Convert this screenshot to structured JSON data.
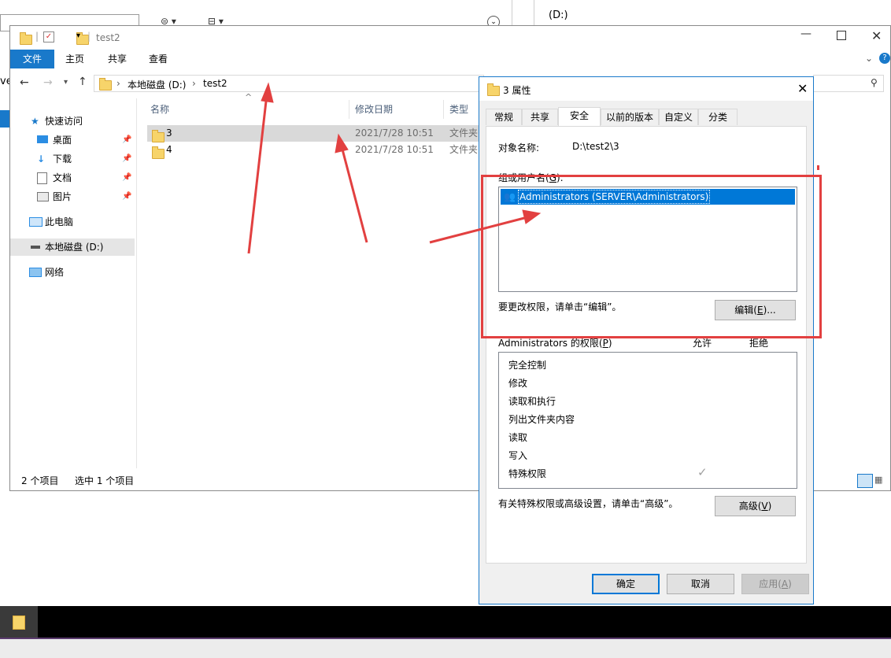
{
  "background_windows": {
    "right_title": "(D:)",
    "left_edge_text": "ve"
  },
  "explorer": {
    "title": "test2",
    "ribbon": {
      "file": "文件",
      "tabs": [
        "主页",
        "共享",
        "查看"
      ]
    },
    "address": {
      "root": "本地磁盘 (D:)",
      "folder": "test2"
    },
    "nav": {
      "quick_access": "快速访问",
      "items": [
        "桌面",
        "下载",
        "文档",
        "图片"
      ],
      "this_pc": "此电脑",
      "drive": "本地磁盘 (D:)",
      "network": "网络"
    },
    "columns": {
      "name": "名称",
      "modified": "修改日期",
      "type": "类型"
    },
    "files": [
      {
        "name": "3",
        "modified": "2021/7/28 10:51",
        "type": "文件夹"
      },
      {
        "name": "4",
        "modified": "2021/7/28 10:51",
        "type": "文件夹"
      }
    ],
    "status": {
      "count": "2 个项目",
      "selected": "选中 1 个项目"
    }
  },
  "dialog": {
    "title": "3 属性",
    "tabs": [
      "常规",
      "共享",
      "安全",
      "以前的版本",
      "自定义",
      "分类"
    ],
    "active_tab": "安全",
    "object_label": "对象名称:",
    "object_value": "D:\\test2\\3",
    "group_label_pre": "组或用户名(",
    "group_label_key": "G",
    "group_label_post": "):",
    "users": [
      "Administrators (SERVER\\Administrators)"
    ],
    "change_hint": "要更改权限，请单击“编辑”。",
    "edit_pre": "编辑(",
    "edit_key": "E",
    "edit_post": ")...",
    "perm_label_pre": "Administrators 的权限(",
    "perm_label_key": "P",
    "perm_label_post": ")",
    "allow": "允许",
    "deny": "拒绝",
    "permissions": [
      "完全控制",
      "修改",
      "读取和执行",
      "列出文件夹内容",
      "读取",
      "写入",
      "特殊权限"
    ],
    "checkmark": "✓",
    "advanced_hint": "有关特殊权限或高级设置，请单击“高级”。",
    "advanced_pre": "高级(",
    "advanced_key": "V",
    "advanced_post": ")",
    "ok": "确定",
    "cancel": "取消",
    "apply_pre": "应用(",
    "apply_key": "A",
    "apply_post": ")"
  },
  "colors": {
    "accent": "#1979ca",
    "highlight": "#0078d7",
    "annotation": "#e24040"
  }
}
